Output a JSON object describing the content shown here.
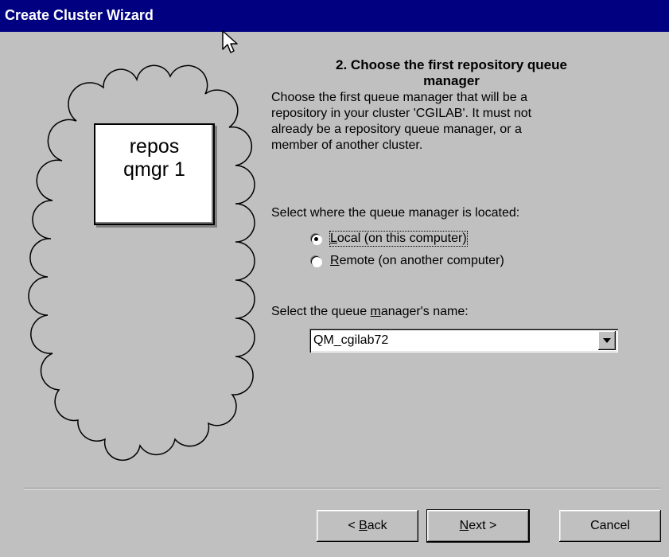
{
  "window": {
    "title": "Create Cluster Wizard"
  },
  "illustration": {
    "box_line1": "repos",
    "box_line2": "qmgr 1"
  },
  "step": {
    "heading_line1": "2. Choose the first repository queue",
    "heading_line2": "manager",
    "description_lines": [
      "Choose the first queue manager that will be a",
      "repository in your cluster 'CGILAB'. It must not",
      "already be a repository queue manager, or a",
      "member of another cluster."
    ]
  },
  "location": {
    "label": "Select where the queue manager is located:",
    "options": [
      {
        "mnemonic": "L",
        "rest": "ocal (on this computer)",
        "selected": true
      },
      {
        "mnemonic": "R",
        "rest": "emote (on another computer)",
        "selected": false
      }
    ]
  },
  "name": {
    "label_pre": "Select the queue ",
    "label_mnemonic": "m",
    "label_post": "anager's name:",
    "selected_value": "QM_cgilab72"
  },
  "buttons": {
    "back_pre": "< ",
    "back_mnemonic": "B",
    "back_post": "ack",
    "next_mnemonic": "N",
    "next_post": "ext >",
    "cancel": "Cancel"
  },
  "colors": {
    "titlebar": "#000080",
    "face": "#c0c0c0"
  },
  "icons": {
    "cursor": "arrow-pointer-icon",
    "dropdown": "dropdown-arrow-icon"
  }
}
